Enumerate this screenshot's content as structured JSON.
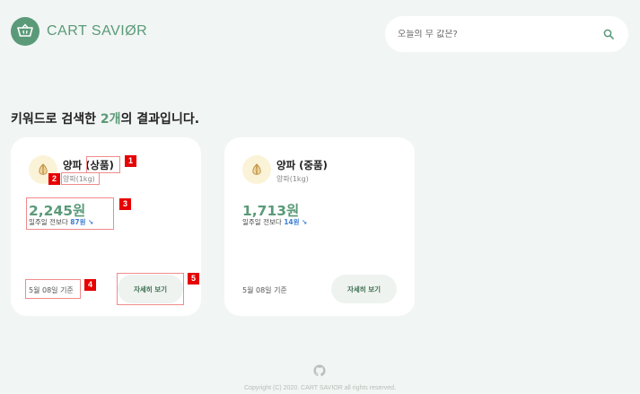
{
  "header": {
    "logo_text": "CART SAVIØR",
    "search": {
      "placeholder": "오늘의 무 값은?"
    }
  },
  "result": {
    "prefix": "키워드로 검색한 ",
    "count": "2개",
    "suffix": "의 결과입니다."
  },
  "cards": [
    {
      "name": "양파 (상품)",
      "unit": "양파(1kg)",
      "price": "2,245원",
      "compare_label": "일주일 전보다",
      "compare_value": "87원",
      "compare_arrow": "↘",
      "date": "5월 08일 기준",
      "button": "자세히 보기"
    },
    {
      "name": "양파 (중품)",
      "unit": "양파(1kg)",
      "price": "1,713원",
      "compare_label": "일주일 전보다",
      "compare_value": "14원",
      "compare_arrow": "↘",
      "date": "5월 08일 기준",
      "button": "자세히 보기"
    }
  ],
  "annotations": [
    "1",
    "2",
    "3",
    "4",
    "5"
  ],
  "footer": {
    "copyright": "Copyright (C) 2020. CART SAVIOR all rights reserved."
  },
  "colors": {
    "background": "#f1f5f3",
    "brand_green": "#5a9a78",
    "price_down_blue": "#3c7ed4",
    "annotation_red": "#e60000"
  },
  "icons": {
    "logo": "shopping-basket-icon",
    "search": "search-icon",
    "product": "onion-icon",
    "footer": "github-icon"
  }
}
